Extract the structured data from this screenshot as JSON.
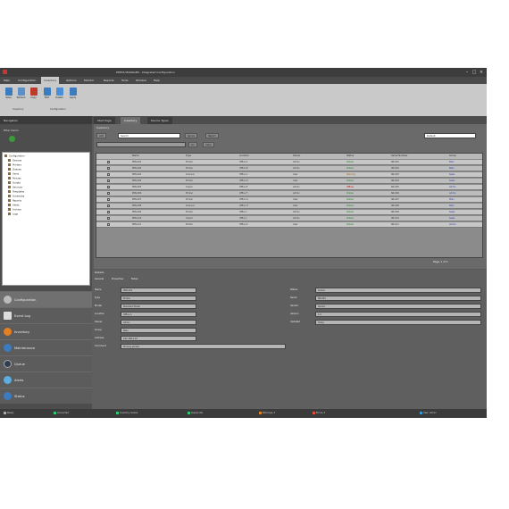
{
  "app": {
    "title": "PRESS MANAGER - Integrated Configuration"
  },
  "menu": [
    "Main",
    "Configuration",
    "Inventory",
    "Options",
    "Monitor",
    "Reports",
    "Tools",
    "Window",
    "Help"
  ],
  "toolbar": {
    "buttons": [
      "Save",
      "Refresh",
      "Copy",
      "Edit",
      "Delete",
      "Apply"
    ],
    "group_labels": [
      "Inventory",
      "Configuration"
    ]
  },
  "navigation": {
    "header": "Navigation",
    "filter_label": "Filter items",
    "tree": [
      "Configuration",
      "Devices",
      "Printers",
      "Queues",
      "Users",
      "Policies",
      "Scripts",
      "Services",
      "Templates",
      "Schedules",
      "Reports",
      "Alerts",
      "Archive",
      "Logs"
    ],
    "items": [
      "Configuration",
      "Event Log",
      "Inventory",
      "Maintenance",
      "Queue",
      "Alerts",
      "Status"
    ]
  },
  "tabs": [
    "Start Page",
    "Inventory",
    "Device Types"
  ],
  "inventory": {
    "header": "Inventory",
    "add_label": "Add",
    "search_label": "Search",
    "ignore_label": "Ignore",
    "report_label": "Report",
    "layout_label": "Default",
    "go_label": "Go",
    "clear_label": "Clear",
    "columns": [
      "",
      "",
      "Name",
      "Type",
      "Location",
      "Owner",
      "Status",
      "Serial Number",
      "Group"
    ],
    "rows": [
      {
        "name": "PRN-001",
        "type": "Printer",
        "location": "Office A",
        "owner": "Admin",
        "status": "Online",
        "serial": "SN-001",
        "group": "Main"
      },
      {
        "name": "PRN-002",
        "type": "Printer",
        "location": "Office B",
        "owner": "Admin",
        "status": "Online",
        "serial": "SN-002",
        "group": "Main"
      },
      {
        "name": "PRN-003",
        "type": "Scanner",
        "location": "Office C",
        "owner": "User",
        "status": "Warning",
        "serial": "SN-003",
        "group": "Sales"
      },
      {
        "name": "PRN-004",
        "type": "Printer",
        "location": "Office D",
        "owner": "User",
        "status": "Online",
        "serial": "SN-004",
        "group": "Sales"
      },
      {
        "name": "PRN-005",
        "type": "Copier",
        "location": "Office E",
        "owner": "Admin",
        "status": "Offline",
        "serial": "SN-005",
        "group": "Admin"
      },
      {
        "name": "PRN-006",
        "type": "Printer",
        "location": "Office F",
        "owner": "Admin",
        "status": "Online",
        "serial": "SN-006",
        "group": "Admin"
      },
      {
        "name": "PRN-007",
        "type": "Printer",
        "location": "Office G",
        "owner": "User",
        "status": "Online",
        "serial": "SN-007",
        "group": "Main"
      },
      {
        "name": "PRN-008",
        "type": "Scanner",
        "location": "Office H",
        "owner": "User",
        "status": "Online",
        "serial": "SN-008",
        "group": "Main"
      },
      {
        "name": "PRN-009",
        "type": "Printer",
        "location": "Office I",
        "owner": "Admin",
        "status": "Online",
        "serial": "SN-009",
        "group": "Sales"
      },
      {
        "name": "PRN-010",
        "type": "Copier",
        "location": "Office J",
        "owner": "Admin",
        "status": "Online",
        "serial": "SN-010",
        "group": "Sales"
      },
      {
        "name": "PRN-011",
        "type": "Printer",
        "location": "Office K",
        "owner": "User",
        "status": "Online",
        "serial": "SN-011",
        "group": "Admin"
      }
    ],
    "pager": "Page 1 of 1"
  },
  "details": {
    "header": "Details",
    "subtabs": [
      "General",
      "Properties",
      "Notes"
    ],
    "fields": [
      {
        "label": "Name",
        "value": "PRN-001"
      },
      {
        "label": "Type",
        "value": "Printer"
      },
      {
        "label": "Model",
        "value": "Standard Model"
      },
      {
        "label": "Location",
        "value": "Office A"
      },
      {
        "label": "Owner",
        "value": "Admin"
      },
      {
        "label": "Group",
        "value": "Main"
      },
      {
        "label": "Address",
        "value": "192.168.1.10"
      },
      {
        "label": "Comment",
        "value": "Primary printer"
      }
    ],
    "right_fields": [
      {
        "label": "Status",
        "value": "Online"
      },
      {
        "label": "Serial",
        "value": "SN-001"
      },
      {
        "label": "Vendor",
        "value": "Vendor"
      },
      {
        "label": "Version",
        "value": "1.0"
      },
      {
        "label": "Updated",
        "value": "Today"
      }
    ]
  },
  "statusbar": [
    "Ready",
    "Connected",
    "Inventory loaded",
    "Queue idle",
    "Warnings: 0",
    "Errors: 0",
    "User: Admin"
  ]
}
